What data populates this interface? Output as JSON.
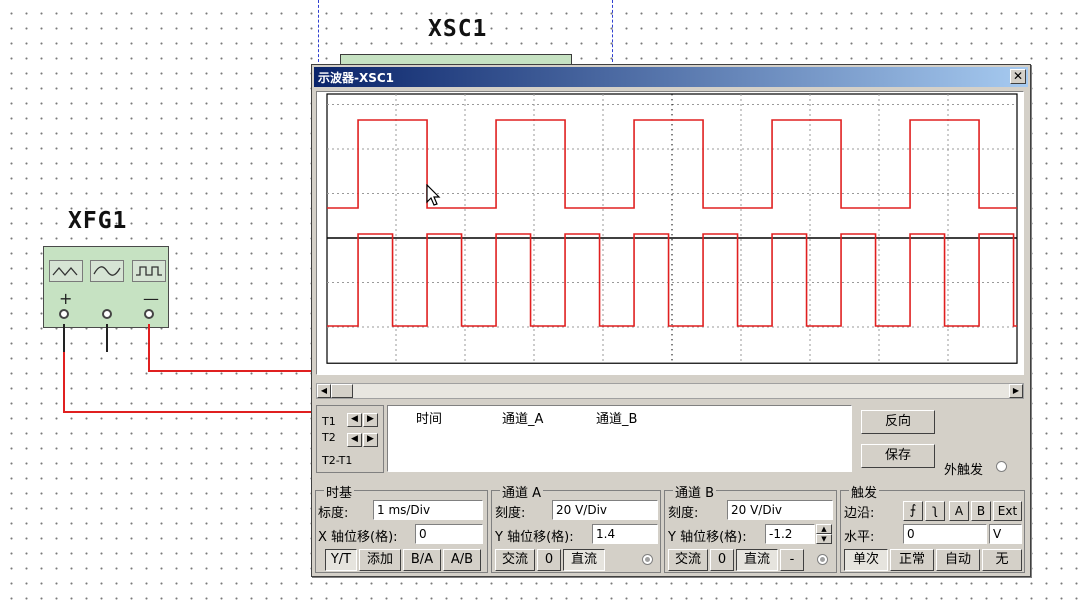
{
  "schematic": {
    "scope_label": "XSC1",
    "generator_label": "XFG1",
    "generator_terminals": {
      "plus": "+",
      "minus": "—"
    },
    "wire_color": "#e02020"
  },
  "window": {
    "title": "示波器-XSC1",
    "close_label": "✕"
  },
  "screen": {
    "trace_color": "#e02020",
    "channel_a": {
      "signal": "square wave",
      "edges_div": [
        0.45,
        1.45,
        2.45,
        3.45,
        4.45,
        5.45,
        6.45,
        7.45,
        8.45,
        9.45
      ]
    },
    "channel_b": {
      "signal": "square wave",
      "edges_div": [
        0.45,
        0.95,
        1.45,
        1.95,
        2.45,
        2.95,
        3.45,
        3.95,
        4.45,
        4.95,
        5.45,
        5.95,
        6.45,
        6.95,
        7.45,
        7.95,
        8.45,
        8.95,
        9.45,
        9.95
      ]
    }
  },
  "cursors": {
    "t1_label": "T1",
    "t2_label": "T2",
    "diff_label": "T2-T1",
    "left_arrow": "◀",
    "right_arrow": "▶"
  },
  "readout": {
    "col_time": "时间",
    "col_a": "通道_A",
    "col_b": "通道_B"
  },
  "buttons": {
    "reverse": "反向",
    "save": "保存",
    "ext_trigger": "外触发"
  },
  "timebase": {
    "title": "时基",
    "scale_label": "标度:",
    "scale_value": "1 ms/Div",
    "xpos_label": "X 轴位移(格):",
    "xpos_value": "0",
    "modes": [
      "Y/T",
      "添加",
      "B/A",
      "A/B"
    ]
  },
  "channel_a": {
    "title": "通道 A",
    "scale_label": "刻度:",
    "scale_value": "20  V/Div",
    "ypos_label": "Y 轴位移(格):",
    "ypos_value": "1.4",
    "coupling": [
      "交流",
      "0",
      "直流"
    ]
  },
  "channel_b": {
    "title": "通道 B",
    "scale_label": "刻度:",
    "scale_value": "20  V/Div",
    "ypos_label": "Y 轴位移(格):",
    "ypos_value": "-1.2",
    "coupling": [
      "交流",
      "0",
      "直流",
      "-"
    ]
  },
  "trigger": {
    "title": "触发",
    "edge_label": "边沿:",
    "edge_rise": "⨍",
    "edge_fall": "ʅ",
    "sources": [
      "A",
      "B",
      "Ext"
    ],
    "level_label": "水平:",
    "level_value": "0",
    "level_unit": "V",
    "modes": [
      "单次",
      "正常",
      "自动",
      "无"
    ]
  }
}
